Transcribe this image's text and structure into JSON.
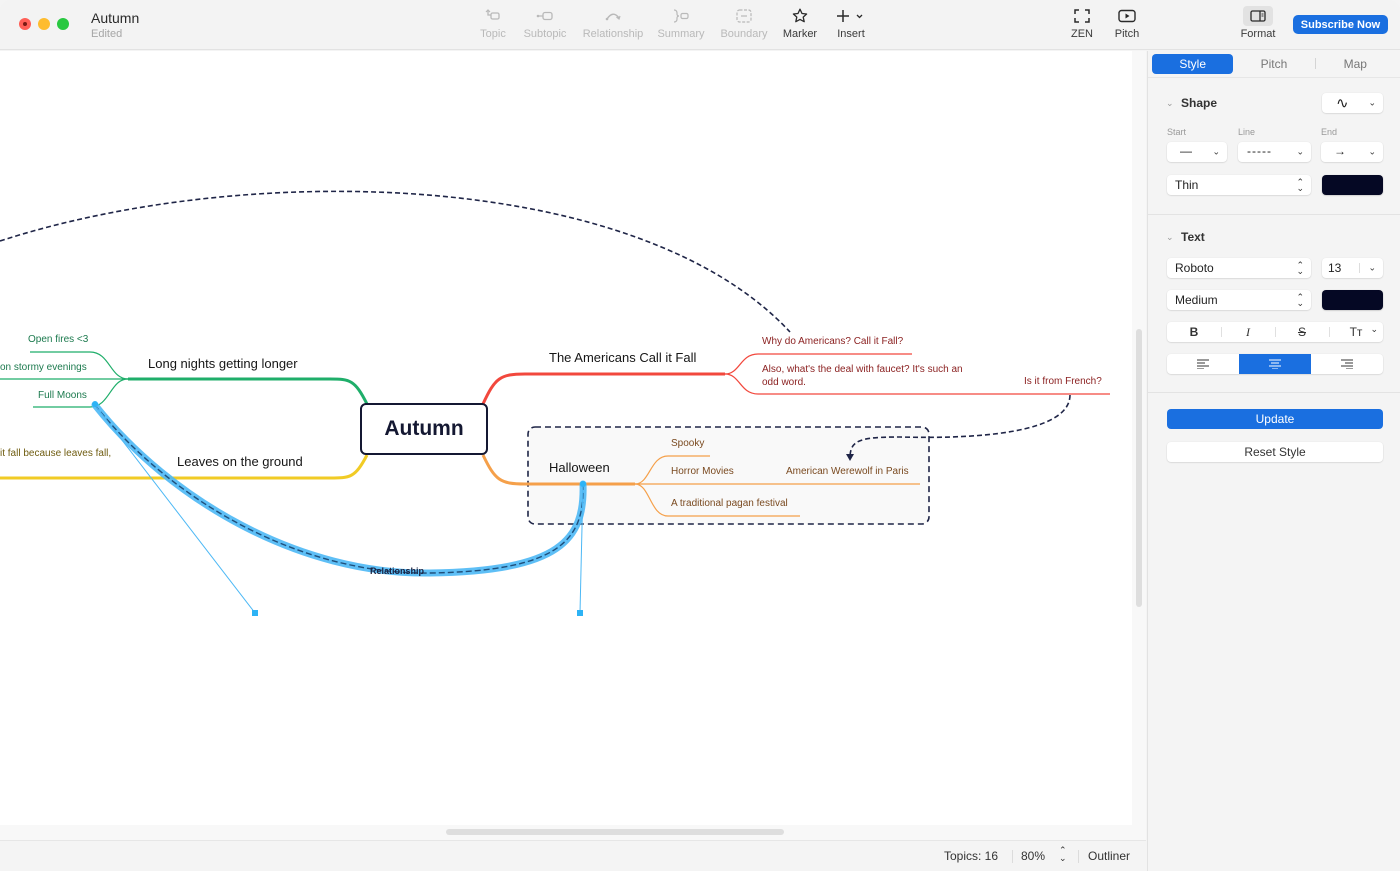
{
  "window": {
    "title": "Autumn",
    "subtitle": "Edited"
  },
  "toolbar": {
    "items": [
      {
        "label": "Topic",
        "icon": "topic-icon",
        "enabled": false
      },
      {
        "label": "Subtopic",
        "icon": "subtopic-icon",
        "enabled": false
      },
      {
        "label": "Relationship",
        "icon": "relationship-icon",
        "enabled": false
      },
      {
        "label": "Summary",
        "icon": "summary-icon",
        "enabled": false
      },
      {
        "label": "Boundary",
        "icon": "boundary-icon",
        "enabled": false
      },
      {
        "label": "Marker",
        "icon": "star-icon",
        "enabled": true
      },
      {
        "label": "Insert",
        "icon": "plus-icon",
        "enabled": true
      }
    ],
    "right_items": [
      {
        "label": "ZEN",
        "icon": "fullscreen-icon"
      },
      {
        "label": "Pitch",
        "icon": "play-icon"
      },
      {
        "label": "Format",
        "icon": "sidebar-icon"
      }
    ],
    "subscribe_label": "Subscribe Now"
  },
  "colors": {
    "accent": "#1a6fe0",
    "branch_green": "#1fae6a",
    "branch_red": "#f2483d",
    "branch_orange": "#f5a04a",
    "branch_yellow": "#f1cb25",
    "relationship_dark": "#1f2547",
    "selection_blue": "#4cb8f5",
    "style_color": "#050824"
  },
  "mindmap": {
    "central": "Autumn",
    "topics": {
      "long_nights": "Long nights getting longer",
      "leaves": "Leaves on the ground",
      "americans": "The Americans Call it Fall",
      "halloween": "Halloween"
    },
    "subtopics": {
      "open_fires": "Open fires <3",
      "stormy": "on stormy evenings",
      "full_moons": "Full Moons",
      "leaves_fall": "it fall because leaves fall,",
      "why_americans": "Why do Americans? Call it Fall?",
      "faucet_line1": "Also, what's the deal with faucet? It's such an",
      "faucet_line2": "odd word.",
      "french": "Is it from French?",
      "spooky": "Spooky",
      "horror": "Horror Movies",
      "werewolf": "American Werewolf in Paris",
      "pagan": "A traditional pagan festival"
    },
    "relationship_label": "Relationship"
  },
  "statusbar": {
    "topics": "Topics: 16",
    "zoom": "80%",
    "outliner": "Outliner"
  },
  "panel": {
    "tabs": [
      {
        "label": "Style",
        "active": true
      },
      {
        "label": "Pitch",
        "active": false
      },
      {
        "label": "Map",
        "active": false
      }
    ],
    "shape": {
      "title": "Shape",
      "shape_value": "∿",
      "start_label": "Start",
      "line_label": "Line",
      "end_label": "End",
      "start_value": "—",
      "line_value": "-----",
      "end_value": "→",
      "thickness": "Thin",
      "color": "#050824"
    },
    "text": {
      "title": "Text",
      "font": "Roboto",
      "size": "13",
      "weight": "Medium",
      "color": "#050824",
      "bold": "B",
      "italic": "I",
      "strike": "S",
      "case": "Tт",
      "align_selected": "center"
    },
    "update_label": "Update",
    "reset_label": "Reset Style"
  }
}
